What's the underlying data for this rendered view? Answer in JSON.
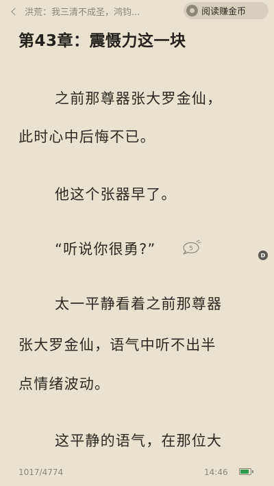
{
  "header": {
    "back_label": "洪荒：我三清不成圣，鸿钧...",
    "coin_button_label": "阅读赚金币"
  },
  "chapter": {
    "title": "第43章：震慑力这一块",
    "lines": [
      "之前那尊器张大罗金仙，",
      "此时心中后悔不已。",
      "他这个张器早了。",
      "“听说你很勇?”",
      "太一平静看着之前那尊器",
      "张大罗金仙，语气中听不出半",
      "点情绪波动。",
      "这平静的语气，在那位大"
    ],
    "comment_count": "5",
    "side_badge": "D"
  },
  "footer": {
    "page_progress": "1017/4774",
    "clock": "14:46",
    "battery_level": 0.9,
    "battery_color": "#2c9a4a"
  },
  "icons": {
    "back": "chevron-left-icon",
    "coin": "coin-icon",
    "comment": "comment-bubble-icon",
    "battery": "battery-icon"
  }
}
